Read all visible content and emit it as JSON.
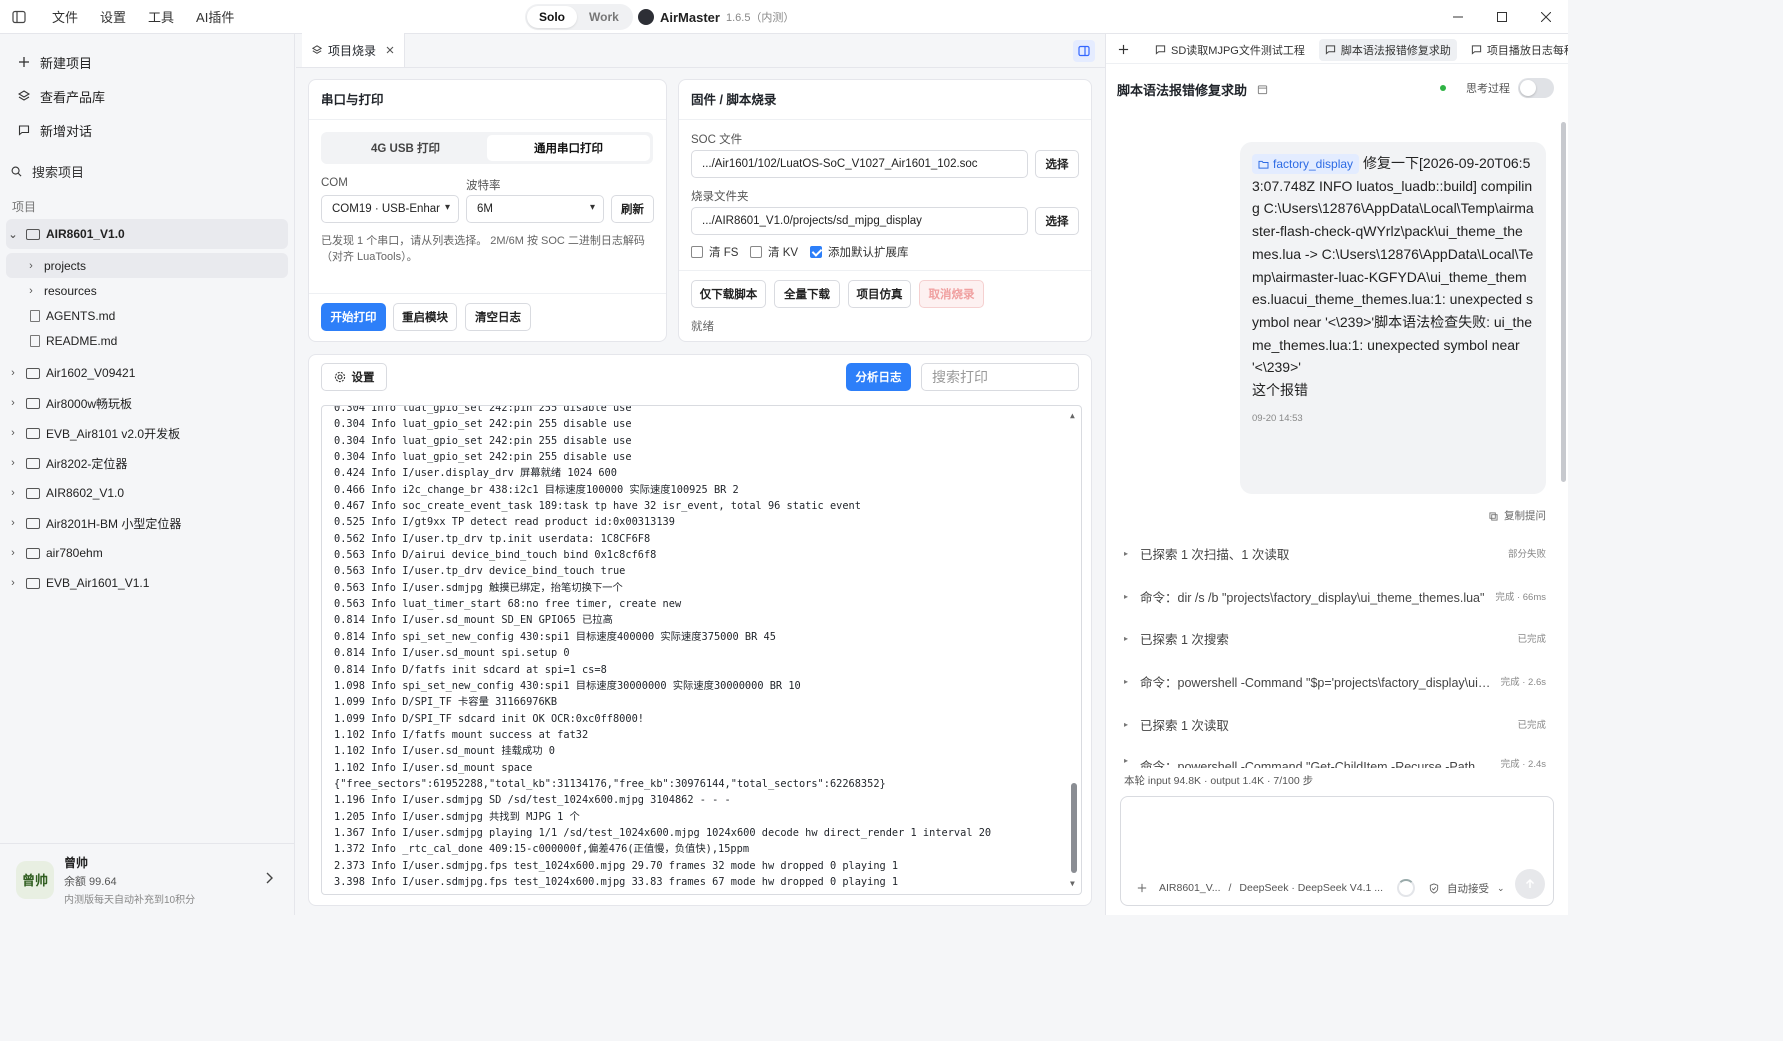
{
  "titlebar": {
    "menu": [
      "文件",
      "设置",
      "工具",
      "AI插件"
    ],
    "modes": [
      "Solo",
      "Work"
    ],
    "active_mode": "Solo",
    "app_name": "AirMaster",
    "version": "1.6.5（内测）"
  },
  "sidebar": {
    "actions": [
      "新建项目",
      "查看产品库",
      "新增对话"
    ],
    "search_label": "搜索项目",
    "section_label": "项目",
    "tree": {
      "root": "AIR8601_V1.0",
      "children": [
        "projects",
        "resources"
      ],
      "files": [
        "AGENTS.md",
        "README.md"
      ],
      "others": [
        "Air1602_V09421",
        "Air8000w畅玩板",
        "EVB_Air8101 v2.0开发板",
        "Air8202-定位器",
        "AIR8602_V1.0",
        "Air8201H-BM 小型定位器",
        "air780ehm",
        "EVB_Air1601_V1.1"
      ]
    },
    "user": {
      "avatar": "曾帅",
      "name": "曾帅",
      "balance": "余额 99.64",
      "note": "内测版每天自动补充到10积分"
    }
  },
  "center": {
    "tab_label": "项目烧录",
    "serial": {
      "title": "串口与打印",
      "seg": [
        "4G USB 打印",
        "通用串口打印"
      ],
      "active_seg": 1,
      "com_label": "COM",
      "com_value": "COM19 · USB-Enhar",
      "baud_label": "波特率",
      "baud_value": "6M",
      "refresh": "刷新",
      "hint": "已发现 1 个串口，请从列表选择。 2M/6M 按 SOC 二进制日志解码（对齐 LuaTools）。",
      "buttons": [
        "开始打印",
        "重启模块",
        "清空日志"
      ]
    },
    "firmware": {
      "title": "固件 / 脚本烧录",
      "soc_label": "SOC 文件",
      "soc_value": ".../Air1601/102/LuatOS-SoC_V1027_Air1601_102.soc",
      "dir_label": "烧录文件夹",
      "dir_value": ".../AIR8601_V1.0/projects/sd_mjpg_display",
      "choose": "选择",
      "checks": [
        {
          "label": "清 FS",
          "checked": false
        },
        {
          "label": "清 KV",
          "checked": false
        },
        {
          "label": "添加默认扩展库",
          "checked": true
        }
      ],
      "buttons": [
        "仅下载脚本",
        "全量下载",
        "项目仿真",
        "取消烧录"
      ],
      "status": "就绪"
    },
    "log": {
      "settings": "设置",
      "analyze": "分析日志",
      "search_placeholder": "搜索打印",
      "lines": [
        "0.304 Info luat_gpio_set 242:pin 255 disable use",
        "0.304 Info luat_gpio_set 242:pin 255 disable use",
        "0.304 Info luat_gpio_set 242:pin 255 disable use",
        "0.304 Info luat_gpio_set 242:pin 255 disable use",
        "0.424 Info I/user.display_drv 屏幕就绪 1024 600",
        "0.466 Info i2c_change_br 438:i2c1 目标速度100000 实际速度100925 BR 2",
        "0.467 Info soc_create_event_task 189:task tp have 32 isr_event, total 96 static event",
        "0.525 Info I/gt9xx TP detect read product id:0x00313139",
        "0.562 Info I/user.tp_drv tp.init userdata: 1C8CF6F8",
        "0.563 Info D/airui device_bind_touch bind 0x1c8cf6f8",
        "0.563 Info I/user.tp_drv device_bind_touch true",
        "0.563 Info I/user.sdmjpg 触摸已绑定，抬笔切换下一个",
        "0.563 Info luat_timer_start 68:no free timer, create new",
        "0.814 Info I/user.sd_mount SD_EN GPIO65 已拉高",
        "0.814 Info spi_set_new_config 430:spi1 目标速度400000 实际速度375000 BR 45",
        "0.814 Info I/user.sd_mount spi.setup 0",
        "0.814 Info D/fatfs init sdcard at spi=1 cs=8",
        "1.098 Info spi_set_new_config 430:spi1 目标速度30000000 实际速度30000000 BR 10",
        "1.099 Info D/SPI_TF 卡容量 31166976KB",
        "1.099 Info D/SPI_TF sdcard init OK OCR:0xc0ff8000!",
        "1.102 Info I/fatfs mount success at fat32",
        "1.102 Info I/user.sd_mount 挂载成功 0",
        "1.102 Info I/user.sd_mount space",
        "{\"free_sectors\":61952288,\"total_kb\":31134176,\"free_kb\":30976144,\"total_sectors\":62268352}",
        "1.196 Info I/user.sdmjpg SD /sd/test_1024x600.mjpg 3104862 - - -",
        "1.205 Info I/user.sdmjpg 共找到 MJPG 1 个",
        "1.367 Info I/user.sdmjpg playing 1/1 /sd/test_1024x600.mjpg 1024x600 decode hw direct_render 1 interval 20",
        "1.372 Info _rtc_cal_done 409:15-c000000f,偏差476(正值慢，负值快),15ppm",
        "2.373 Info I/user.sdmjpg.fps test_1024x600.mjpg 29.70 frames 32 mode hw dropped 0 playing 1",
        "3.398 Info I/user.sdmjpg.fps test_1024x600.mjpg 33.83 frames 67 mode hw dropped 0 playing 1"
      ]
    }
  },
  "right": {
    "tabs": [
      "SD读取MJPG文件测试工程",
      "脚本语法报错修复求助",
      "项目播放日志每秒"
    ],
    "active_tab": 1,
    "title": "脚本语法报错修复求助",
    "think_label": "思考过程",
    "message": {
      "chip": "factory_display",
      "text": "修复一下[2026-09-20T06:53:07.748Z INFO  luatos_luadb::build] compiling C:\\Users\\12876\\AppData\\Local\\Temp\\airmaster-flash-check-qWYrlz\\pack\\ui_theme_themes.lua -> C:\\Users\\12876\\AppData\\Local\\Temp\\airmaster-luac-KGFYDA\\ui_theme_themes.luacui_theme_themes.lua:1: unexpected symbol near '<\\239>'脚本语法检查失败: ui_theme_themes.lua:1: unexpected symbol near '<\\239>'",
      "tail": "这个报错",
      "time": "09-20 14:53"
    },
    "copy_label": "复制提问",
    "steps": [
      {
        "text": "已探索 1 次扫描、1 次读取",
        "status": "部分失败"
      },
      {
        "text": "命令：dir /s /b \"projects\\factory_display\\ui_theme_themes.lua\"",
        "status": "完成 · 66ms"
      },
      {
        "text": "已探索 1 次搜索",
        "status": "已完成"
      },
      {
        "text": "命令：powershell -Command \"$p='projects\\factory_display\\ui_theme_themes.lua'\"",
        "status": "完成 · 2.6s"
      },
      {
        "text": "已探索 1 次读取",
        "status": "已完成"
      },
      {
        "text": "命令：powershell -Command \"Get-ChildItem -Recurse -Path",
        "status": "完成 · 2.4s"
      }
    ],
    "usage": "本轮 input 94.8K · output 1.4K · 7/100 步",
    "composer": {
      "project": "AIR8601_V...",
      "sep": "/",
      "model": "DeepSeek · DeepSeek V4.1 ...",
      "auto_accept": "自动接受"
    }
  }
}
